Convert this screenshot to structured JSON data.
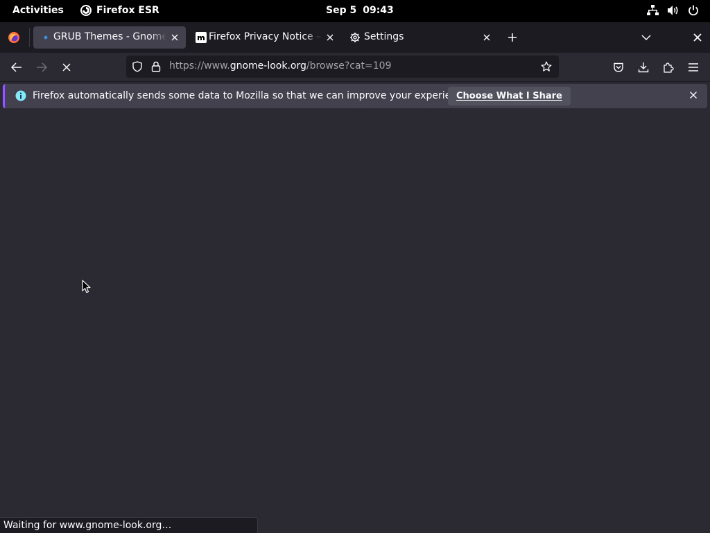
{
  "topbar": {
    "activities_label": "Activities",
    "app_name": "Firefox ESR",
    "date": "Sep 5",
    "time": "09:43",
    "tray_icons": [
      "network-icon",
      "volume-icon",
      "power-icon"
    ]
  },
  "tabs": [
    {
      "title": "GRUB Themes - Gnome-l",
      "active": true,
      "favicon": "gnome-look-dot"
    },
    {
      "title": "Firefox Privacy Notice — M",
      "active": false,
      "favicon": "mozilla-m"
    },
    {
      "title": "Settings",
      "active": false,
      "favicon": "gear-icon"
    }
  ],
  "navbar": {
    "url_prefix": "https://www.",
    "url_host": "gnome-look.org",
    "url_path": "/browse?cat=109"
  },
  "notification": {
    "message": "Firefox automatically sends some data to Mozilla so that we can improve your experience.",
    "button_label": "Choose What I Share"
  },
  "status_text": "Waiting for www.gnome-look.org…",
  "colors": {
    "content_bg": "#2b2a33",
    "tabstrip_bg": "#1c1b22",
    "active_tab_bg": "#42414d",
    "notification_accent": "#9059ff",
    "info_icon": "#80ebff"
  }
}
